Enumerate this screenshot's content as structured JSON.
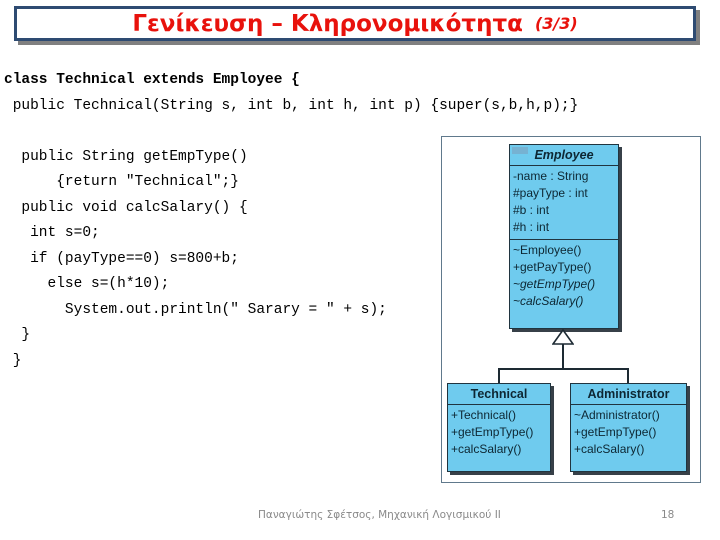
{
  "slide": {
    "title": "Γενίκευση – Κληρονομικότητα",
    "title_suffix": "(3/3)",
    "title_color": "#e8120c",
    "title_border_color": "#2e4b72"
  },
  "code": {
    "lines": [
      {
        "text": "class Technical extends Employee {",
        "bold": true
      },
      {
        "text": " public Technical(String s, int b, int h, int p) {super(s,b,h,p);}",
        "bold": false
      },
      {
        "text": "",
        "bold": false
      },
      {
        "text": "  public String getEmpType()",
        "bold": false
      },
      {
        "text": "      {return \"Technical\";}",
        "bold": false
      },
      {
        "text": "  public void calcSalary() {",
        "bold": false
      },
      {
        "text": "   int s=0;",
        "bold": false
      },
      {
        "text": "   if (payType==0) s=800+b;",
        "bold": false
      },
      {
        "text": "     else s=(h*10);",
        "bold": false
      },
      {
        "text": "       System.out.println(\" Sarary = \" + s);",
        "bold": false
      },
      {
        "text": "  }",
        "bold": false
      },
      {
        "text": " }",
        "bold": false
      }
    ]
  },
  "diagram": {
    "fill_color": "#6fcbee",
    "border_color": "#20343f",
    "classes": [
      {
        "name": "Employee",
        "abstract": true,
        "attributes": [
          "-name : String",
          "#payType : int",
          "#b : int",
          "#h : int"
        ],
        "methods": [
          {
            "text": "~Employee()",
            "abstract": false
          },
          {
            "text": "+getPayType()",
            "abstract": false
          },
          {
            "text": "~getEmpType()",
            "abstract": true
          },
          {
            "text": "~calcSalary()",
            "abstract": true
          }
        ]
      },
      {
        "name": "Technical",
        "abstract": false,
        "attributes": [],
        "methods": [
          {
            "text": "+Technical()",
            "abstract": false
          },
          {
            "text": "+getEmpType()",
            "abstract": false
          },
          {
            "text": "+calcSalary()",
            "abstract": false
          }
        ]
      },
      {
        "name": "Administrator",
        "abstract": false,
        "attributes": [],
        "methods": [
          {
            "text": "~Administrator()",
            "abstract": false
          },
          {
            "text": "+getEmpType()",
            "abstract": false
          },
          {
            "text": "+calcSalary()",
            "abstract": false
          }
        ]
      }
    ],
    "relationship": "generalization"
  },
  "footer": {
    "author": "Παναγιώτης Σφέτσος,  Μηχανική Λογισμικού ΙΙ",
    "page": "18"
  }
}
